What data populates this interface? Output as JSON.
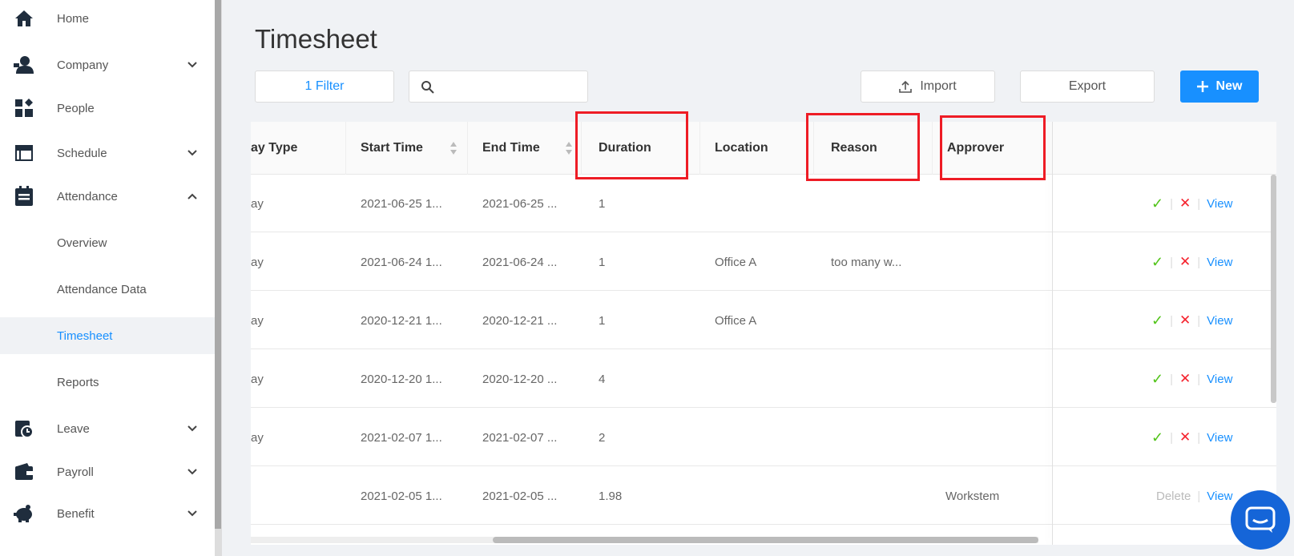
{
  "sidebar": {
    "items": [
      {
        "label": "Home",
        "icon": "home-icon"
      },
      {
        "label": "Company",
        "icon": "company-icon",
        "chevron": "down"
      },
      {
        "label": "People",
        "icon": "people-icon"
      },
      {
        "label": "Schedule",
        "icon": "schedule-icon",
        "chevron": "down"
      },
      {
        "label": "Attendance",
        "icon": "attendance-icon",
        "chevron": "up"
      },
      {
        "label": "Overview"
      },
      {
        "label": "Attendance Data"
      },
      {
        "label": "Timesheet",
        "active": true
      },
      {
        "label": "Reports"
      },
      {
        "label": "Leave",
        "icon": "leave-icon",
        "chevron": "down"
      },
      {
        "label": "Payroll",
        "icon": "payroll-icon",
        "chevron": "down"
      },
      {
        "label": "Benefit",
        "icon": "benefit-icon",
        "chevron": "down"
      }
    ]
  },
  "header": {
    "title": "Timesheet",
    "filter_label": "1  Filter",
    "search_placeholder": "",
    "import_label": "Import",
    "export_label": "Export",
    "new_label": "New"
  },
  "table": {
    "columns": [
      "ay Type",
      "Start Time",
      "End Time",
      "Duration",
      "Location",
      "Reason",
      "Approver"
    ],
    "rows": [
      {
        "day_type": "ay",
        "start": "2021-06-25 1...",
        "end": "2021-06-25 ...",
        "duration": "1",
        "location": "",
        "reason": "",
        "approver": "",
        "actions": [
          "approve",
          "reject",
          "View"
        ]
      },
      {
        "day_type": "ay",
        "start": "2021-06-24 1...",
        "end": "2021-06-24 ...",
        "duration": "1",
        "location": "Office A",
        "reason": "too many w...",
        "approver": "",
        "actions": [
          "approve",
          "reject",
          "View"
        ]
      },
      {
        "day_type": "ay",
        "start": "2020-12-21 1...",
        "end": "2020-12-21 ...",
        "duration": "1",
        "location": "Office A",
        "reason": "",
        "approver": "",
        "actions": [
          "approve",
          "reject",
          "View"
        ]
      },
      {
        "day_type": "ay",
        "start": "2020-12-20 1...",
        "end": "2020-12-20 ...",
        "duration": "4",
        "location": "",
        "reason": "",
        "approver": "",
        "actions": [
          "approve",
          "reject",
          "View"
        ]
      },
      {
        "day_type": "ay",
        "start": "2021-02-07 1...",
        "end": "2021-02-07 ...",
        "duration": "2",
        "location": "",
        "reason": "",
        "approver": "",
        "actions": [
          "approve",
          "reject",
          "View"
        ]
      },
      {
        "day_type": "",
        "start": "2021-02-05 1...",
        "end": "2021-02-05 ...",
        "duration": "1.98",
        "location": "",
        "reason": "",
        "approver": "Workstem",
        "actions": [
          "Delete",
          "View"
        ]
      }
    ],
    "action_labels": {
      "view": "View",
      "delete": "Delete"
    }
  },
  "colors": {
    "accent": "#1890ff",
    "approve": "#52c41a",
    "reject": "#f5222d",
    "highlight": "#ee1c25",
    "chat": "#1565d8"
  }
}
